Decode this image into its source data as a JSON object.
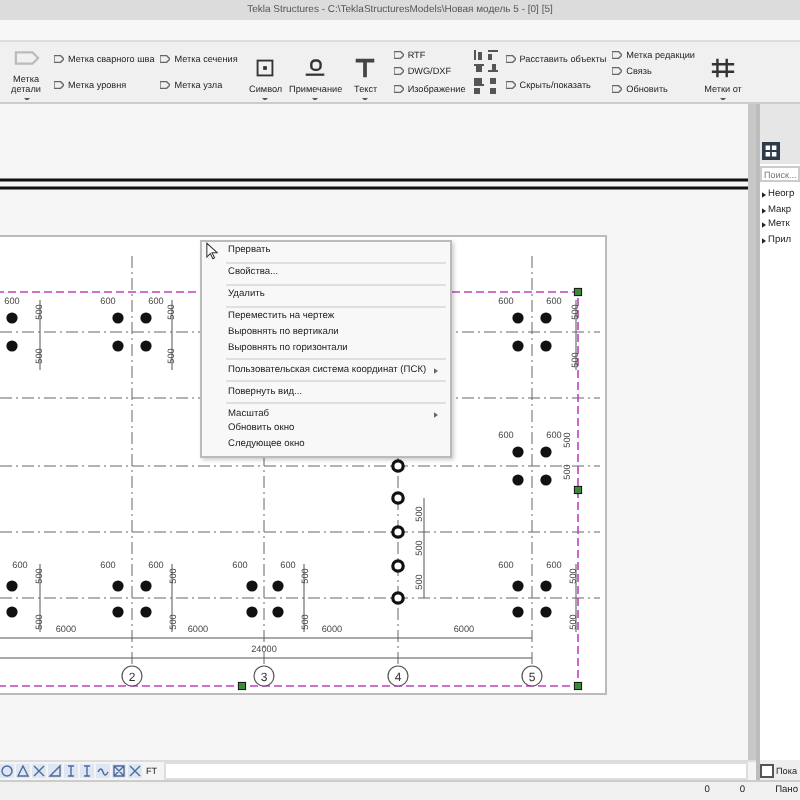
{
  "window": {
    "title": "Tekla Structures - C:\\TeklaStructuresModels\\Новая модель 5 - [0] [5]"
  },
  "ribbon": [
    {
      "kind": "large",
      "label": "Метка детали"
    },
    {
      "kind": "column",
      "items": [
        "Метка сварного шва",
        "Метка уровня"
      ]
    },
    {
      "kind": "column",
      "items": [
        "Метка сечения",
        "Метка узла"
      ]
    },
    {
      "kind": "large",
      "label": "Символ"
    },
    {
      "kind": "large",
      "label": "Примечание"
    },
    {
      "kind": "large",
      "label": "Текст"
    },
    {
      "kind": "column",
      "items": [
        "RTF",
        "DWG/DXF",
        "Изображение"
      ]
    },
    {
      "kind": "grid"
    },
    {
      "kind": "column",
      "items": [
        "Расставить объекты",
        "Скрыть/показать"
      ]
    },
    {
      "kind": "column",
      "items": [
        "Метка редакции",
        "Связь",
        "Обновить"
      ]
    },
    {
      "kind": "large",
      "label": "Метки от"
    }
  ],
  "drawing": {
    "axes": [
      "2",
      "3",
      "4",
      "5"
    ],
    "spans": [
      "6000",
      "6000",
      "6000",
      "6000"
    ],
    "overall": "24000",
    "horizontal_dims": [
      "600",
      "600",
      "600",
      "600",
      "600",
      "600",
      "600",
      "600",
      "600",
      "600",
      "600",
      "600",
      "600",
      "600"
    ],
    "vertical_dims": [
      "500",
      "500",
      "500",
      "500",
      "500",
      "500",
      "500",
      "500",
      "500",
      "500",
      "500",
      "500",
      "500",
      "500",
      "500",
      "500",
      "500",
      "500",
      "500"
    ]
  },
  "context_menu": [
    {
      "kind": "item",
      "label": "Прервать",
      "submenu": false
    },
    {
      "kind": "separator"
    },
    {
      "kind": "item",
      "label": "Свойства...",
      "submenu": false
    },
    {
      "kind": "separator"
    },
    {
      "kind": "item",
      "label": "Удалить",
      "submenu": false
    },
    {
      "kind": "separator"
    },
    {
      "kind": "item",
      "label": "Переместить на чертеж",
      "submenu": false
    },
    {
      "kind": "item",
      "label": "Выровнять по вертикали",
      "submenu": false
    },
    {
      "kind": "item",
      "label": "Выровнять по горизонтали",
      "submenu": false
    },
    {
      "kind": "separator"
    },
    {
      "kind": "item",
      "label": "Пользовательская система координат (ПСК)",
      "submenu": true
    },
    {
      "kind": "separator"
    },
    {
      "kind": "item",
      "label": "Повернуть вид...",
      "submenu": false
    },
    {
      "kind": "separator"
    },
    {
      "kind": "item",
      "label": "Масштаб",
      "submenu": true
    },
    {
      "kind": "item",
      "label": "Обновить окно",
      "submenu": false
    },
    {
      "kind": "item",
      "label": "Следующее окно",
      "submenu": false
    }
  ],
  "side_panel": {
    "search": {
      "placeholder": "Поиск..."
    },
    "tree": [
      {
        "label": "Неогр"
      },
      {
        "label": "Макр"
      },
      {
        "label": "Метк"
      },
      {
        "label": "Прил"
      }
    ],
    "checkbox": {
      "label": "Пока",
      "checked": false
    }
  },
  "bottom_toolbar": {
    "text": "FT"
  },
  "status_bar": [
    "0",
    "0",
    "Пано"
  ]
}
